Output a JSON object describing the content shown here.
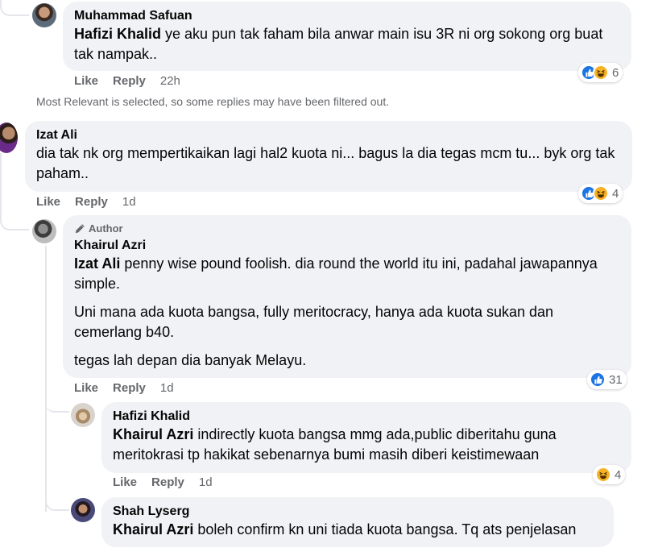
{
  "notice": "Most Relevant is selected, so some replies may have been filtered out.",
  "colors": {
    "accent": "#1b74e4",
    "haha": "#f7b125",
    "bubble": "#f0f2f5",
    "muted": "#65676b"
  },
  "comments": [
    {
      "author": "Muhammad Safuan",
      "mention": "Hafizi Khalid",
      "text": " ye aku pun tak faham bila anwar main isu 3R ni org sokong org buat tak nampak..",
      "like": "Like",
      "reply": "Reply",
      "time": "22h",
      "reaction_count": "6",
      "reaction_icons": [
        "like-icon",
        "haha-icon"
      ]
    },
    {
      "author": "Izat Ali",
      "text": "dia tak nk org mempertikaikan lagi hal2 kuota ni... bagus la dia tegas mcm tu... byk org tak paham..",
      "like": "Like",
      "reply": "Reply",
      "time": "1d",
      "reaction_count": "4",
      "reaction_icons": [
        "like-icon",
        "haha-icon"
      ]
    },
    {
      "badge": "Author",
      "author": "Khairul Azri",
      "mention": "Izat Ali",
      "text": " penny wise pound foolish. dia round the world itu ini, padahal jawapannya simple.",
      "text2": "Uni mana ada kuota bangsa, fully meritocracy, hanya ada kuota sukan dan cemerlang b40.",
      "text3": "tegas lah depan dia banyak Melayu.",
      "like": "Like",
      "reply": "Reply",
      "time": "1d",
      "reaction_count": "31",
      "reaction_icons": [
        "like-icon"
      ]
    },
    {
      "author": "Hafizi Khalid",
      "mention": "Khairul Azri",
      "text": " indirectly kuota bangsa mmg ada,public diberitahu guna meritokrasi tp hakikat sebenarnya bumi masih diberi keistimewaan",
      "like": "Like",
      "reply": "Reply",
      "time": "1d",
      "reaction_count": "4",
      "reaction_icons": [
        "haha-icon"
      ]
    },
    {
      "author": "Shah Lyserg",
      "mention": "Khairul Azri",
      "text": " boleh confirm kn uni tiada kuota bangsa. Tq ats penjelasan"
    }
  ]
}
